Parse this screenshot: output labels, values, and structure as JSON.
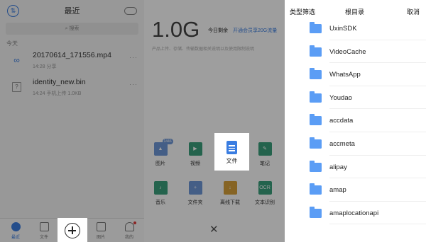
{
  "recent": {
    "title": "最近",
    "search_placeholder": "搜索",
    "sync_icon": "sync-icon",
    "section_label": "今天",
    "files": [
      {
        "name": "20170614_171556.mp4",
        "meta": "14:28  分享",
        "icon": "link-icon",
        "more": "···"
      },
      {
        "name": "identity_new.bin",
        "meta": "14:24  手机上传  1.0KB",
        "icon": "unknown-file-icon",
        "more": "···"
      }
    ],
    "tabs": [
      {
        "label": "最近",
        "icon": "clock-icon"
      },
      {
        "label": "文件",
        "icon": "file-icon"
      },
      {
        "label": "图片",
        "icon": "image-icon"
      },
      {
        "label": "我的",
        "icon": "user-icon"
      }
    ]
  },
  "upload": {
    "storage_value": "1.0G",
    "remaining_label": "今日剩余",
    "upgrade_link": "开通会员享20G流量",
    "description": "产品上传、存储、传输数据相关说明以及使用限制说明",
    "items": [
      {
        "label": "图片",
        "icon": "photo-icon"
      },
      {
        "label": "视频",
        "icon": "video-icon"
      },
      {
        "label": "文件",
        "icon": "document-icon"
      },
      {
        "label": "笔记",
        "icon": "note-icon"
      },
      {
        "label": "音乐",
        "icon": "music-icon"
      },
      {
        "label": "文件夹",
        "icon": "folder-add-icon"
      },
      {
        "label": "离线下载",
        "icon": "download-icon"
      },
      {
        "label": "文本识别",
        "icon": "ocr-icon"
      }
    ],
    "photo_badge": "1446",
    "close_icon": "close-icon"
  },
  "picker": {
    "filter_label": "类型筛选",
    "title": "根目录",
    "cancel_label": "取消",
    "folders": [
      "UxinSDK",
      "VideoCache",
      "WhatsApp",
      "Youdao",
      "accdata",
      "accmeta",
      "alipay",
      "amap",
      "amaplocationapi"
    ]
  },
  "colors": {
    "accent": "#3a7de1",
    "folder": "#5b9df5"
  }
}
